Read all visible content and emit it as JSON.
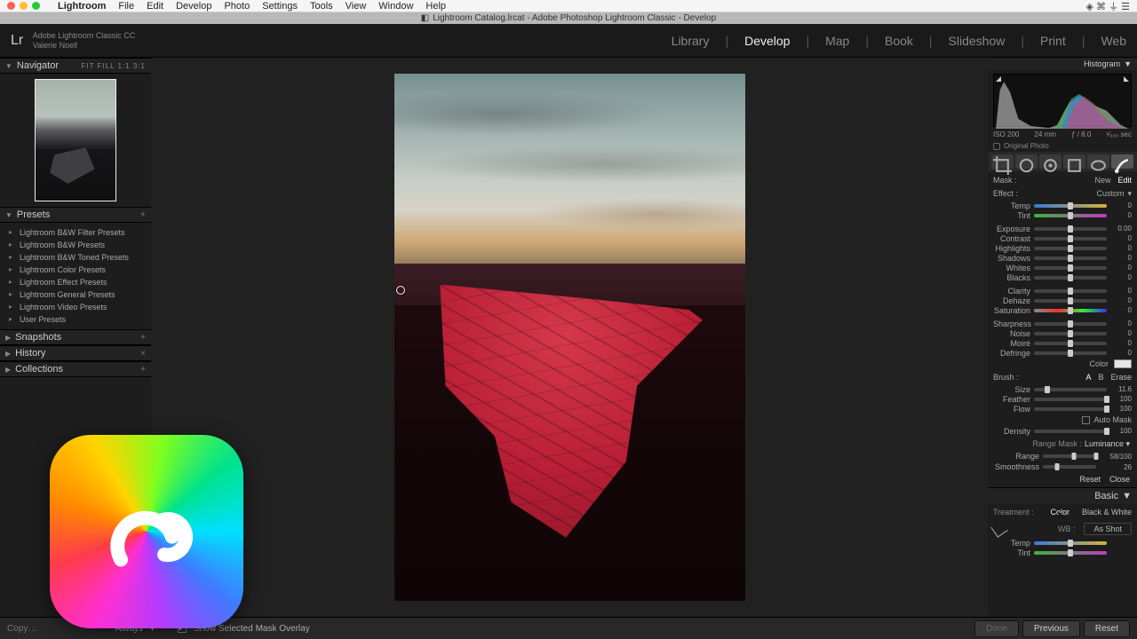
{
  "mac_menu": {
    "app": "Lightroom",
    "items": [
      "File",
      "Edit",
      "Develop",
      "Photo",
      "Settings",
      "Tools",
      "View",
      "Window",
      "Help"
    ]
  },
  "doc_titlebar": "Lightroom Catalog.lrcat - Adobe Photoshop Lightroom Classic - Develop",
  "identity": {
    "product": "Adobe Lightroom Classic CC",
    "user": "Valerie Noell"
  },
  "modules": [
    "Library",
    "Develop",
    "Map",
    "Book",
    "Slideshow",
    "Print",
    "Web"
  ],
  "active_module": "Develop",
  "navigator": {
    "title": "Navigator",
    "sizes": "FIT  FILL  1:1  3:1"
  },
  "presets": {
    "title": "Presets",
    "items": [
      "Lightroom B&W Filter Presets",
      "Lightroom B&W Presets",
      "Lightroom B&W Toned Presets",
      "Lightroom Color Presets",
      "Lightroom Effect Presets",
      "Lightroom General Presets",
      "Lightroom Video Presets",
      "User Presets"
    ]
  },
  "snapshots": {
    "title": "Snapshots"
  },
  "history": {
    "title": "History"
  },
  "collections": {
    "title": "Collections"
  },
  "histogram": {
    "title": "Histogram",
    "iso": "ISO 200",
    "focal": "24 mm",
    "aperture": "ƒ / 8.0",
    "shutter": "¹⁄₆₀₀ sec",
    "original": "Original Photo"
  },
  "mask": {
    "label": "Mask :",
    "new": "New",
    "edit": "Edit"
  },
  "effect": {
    "label": "Effect :",
    "value": "Custom"
  },
  "sliders": [
    {
      "label": "Temp",
      "v": "0",
      "cls": "temp"
    },
    {
      "label": "Tint",
      "v": "0",
      "cls": "tint"
    },
    {
      "label": "Exposure",
      "v": "0.00"
    },
    {
      "label": "Contrast",
      "v": "0"
    },
    {
      "label": "Highlights",
      "v": "0"
    },
    {
      "label": "Shadows",
      "v": "0"
    },
    {
      "label": "Whites",
      "v": "0"
    },
    {
      "label": "Blacks",
      "v": "0"
    },
    {
      "label": "Clarity",
      "v": "0"
    },
    {
      "label": "Dehaze",
      "v": "0"
    },
    {
      "label": "Saturation",
      "v": "0",
      "cls": "sat"
    },
    {
      "label": "Sharpness",
      "v": "0"
    },
    {
      "label": "Noise",
      "v": "0"
    },
    {
      "label": "Moiré",
      "v": "0"
    },
    {
      "label": "Defringe",
      "v": "0"
    }
  ],
  "color_label": "Color",
  "brush": {
    "label": "Brush :",
    "tabs": [
      "A",
      "B",
      "Erase"
    ],
    "size": {
      "label": "Size",
      "v": "11.6",
      "pos": 18
    },
    "feather": {
      "label": "Feather",
      "v": "100",
      "pos": 100
    },
    "flow": {
      "label": "Flow",
      "v": "100",
      "pos": 100
    },
    "automask": "Auto Mask",
    "density": {
      "label": "Density",
      "v": "100",
      "pos": 100
    }
  },
  "range_mask": {
    "title_dim": "Range Mask :",
    "title": "Luminance",
    "range": {
      "label": "Range",
      "v": "58/100",
      "a": 58,
      "b": 100
    },
    "smooth": {
      "label": "Smoothness",
      "v": "26",
      "pos": 26
    },
    "reset": "Reset",
    "close": "Close"
  },
  "basic": {
    "title": "Basic",
    "treat_label": "Treatment :",
    "treat_a": "Color",
    "treat_b": "Black & White",
    "wb_label": "WB :",
    "wb_value": "As Shot",
    "temp": "Temp",
    "tint": "Tint"
  },
  "toolbar": {
    "copy": "Copy…",
    "always": "Always",
    "mask_overlay": "Show Selected Mask Overlay",
    "done": "Done",
    "previous": "Previous",
    "reset": "Reset"
  }
}
